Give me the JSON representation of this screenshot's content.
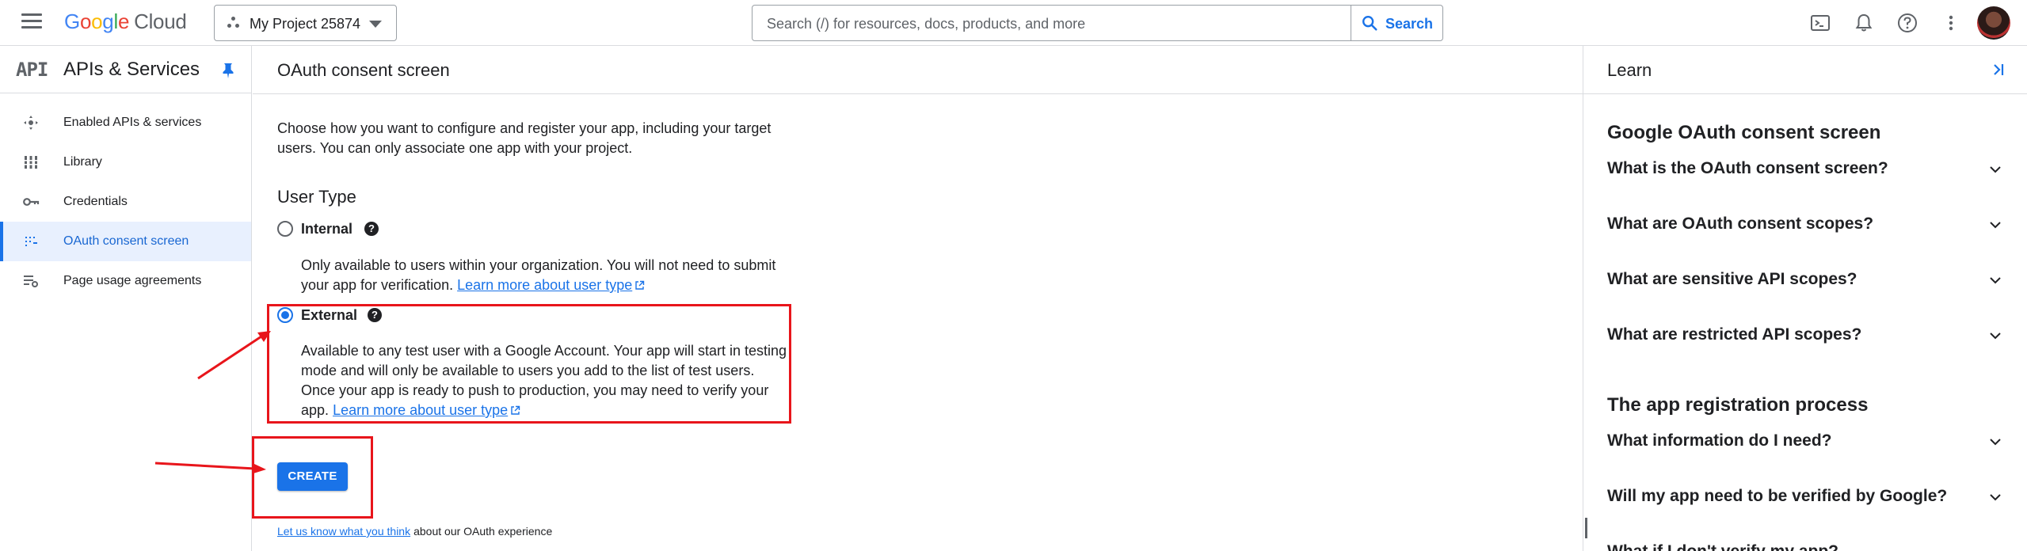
{
  "topbar": {
    "logo_google": "Google",
    "logo_cloud": "Cloud",
    "project_name": "My Project 25874",
    "search_placeholder": "Search (/) for resources, docs, products, and more",
    "search_button": "Search"
  },
  "sidebar": {
    "logo_text": "API",
    "title": "APIs & Services",
    "items": [
      {
        "label": "Enabled APIs & services",
        "icon": "hub-icon"
      },
      {
        "label": "Library",
        "icon": "library-icon"
      },
      {
        "label": "Credentials",
        "icon": "key-icon"
      },
      {
        "label": "OAuth consent screen",
        "icon": "consent-icon",
        "active": true
      },
      {
        "label": "Page usage agreements",
        "icon": "settings-list-icon"
      }
    ]
  },
  "main": {
    "title": "OAuth consent screen",
    "intro": "Choose how you want to configure and register your app, including your target users. You can only associate one app with your project.",
    "user_type_heading": "User Type",
    "internal": {
      "label": "Internal",
      "description": "Only available to users within your organization. You will not need to submit your app for verification.",
      "link": "Learn more about user type",
      "selected": false
    },
    "external": {
      "label": "External",
      "description": "Available to any test user with a Google Account. Your app will start in testing mode and will only be available to users you add to the list of test users. Once your app is ready to push to production, you may need to verify your app.",
      "link": "Learn more about user type",
      "selected": true
    },
    "create_button": "CREATE",
    "footer_link": "Let us know what you think",
    "footer_text": "about our OAuth experience"
  },
  "learn": {
    "title": "Learn",
    "section1_title": "Google OAuth consent screen",
    "section1_items": [
      "What is the OAuth consent screen?",
      "What are OAuth consent scopes?",
      "What are sensitive API scopes?",
      "What are restricted API scopes?"
    ],
    "section2_title": "The app registration process",
    "section2_items": [
      "What information do I need?",
      "Will my app need to be verified by Google?",
      "What if I don't verify my app?"
    ]
  },
  "colors": {
    "accent": "#1a73e8",
    "annotation_red": "#e8151b",
    "active_nav_bg": "#e8f0fe"
  }
}
